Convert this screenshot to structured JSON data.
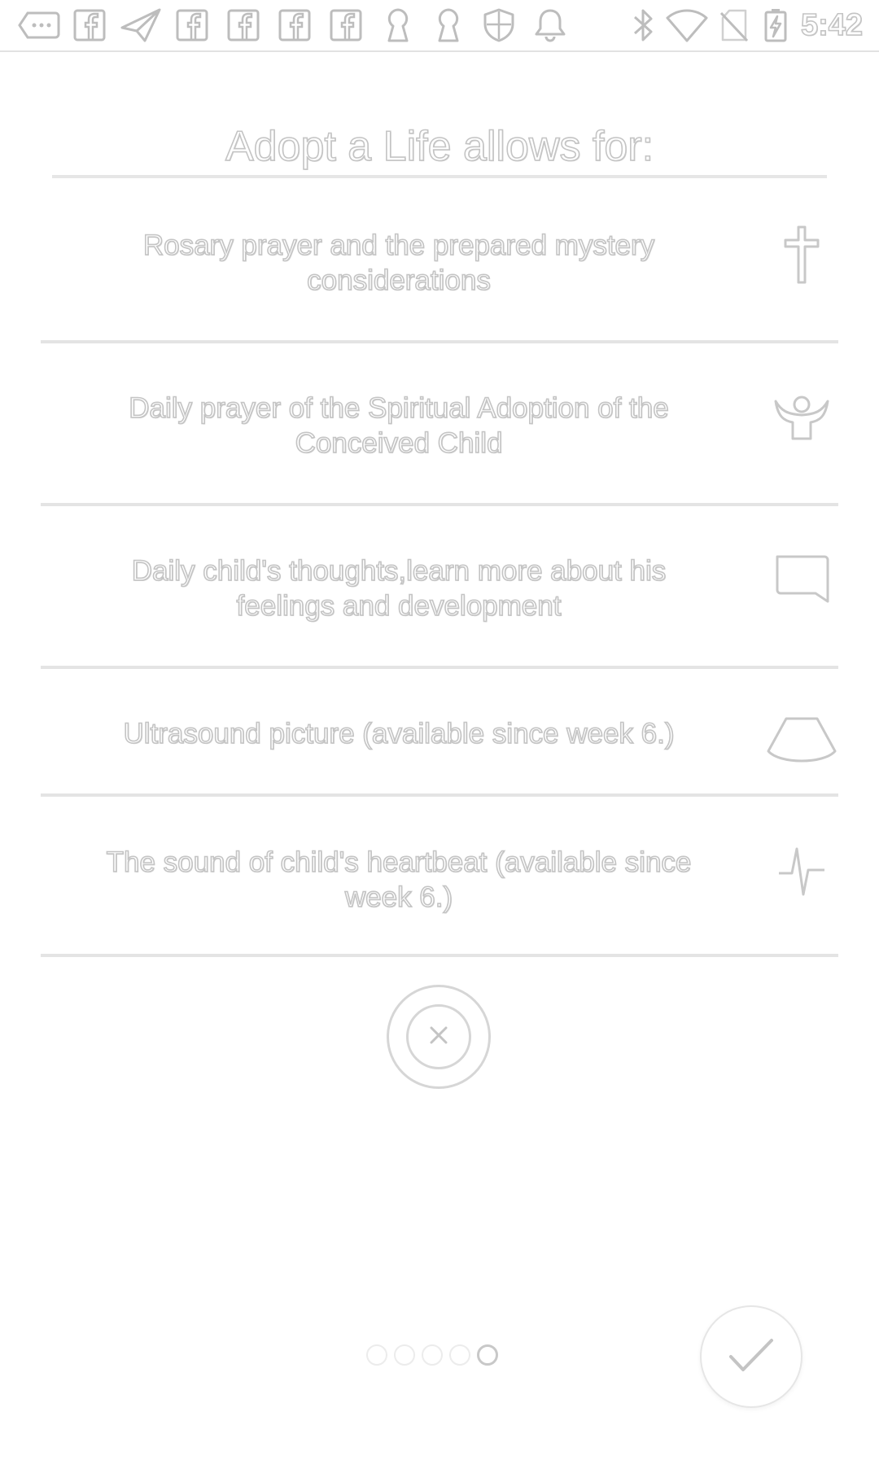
{
  "status_bar": {
    "time": "5:42",
    "notification_icons": [
      "chat-bubble-icon",
      "facebook-icon",
      "send-icon",
      "facebook-icon",
      "facebook-icon",
      "facebook-icon",
      "facebook-icon",
      "keyhole-icon",
      "keyhole-icon",
      "shield-icon",
      "bell-icon"
    ],
    "system_icons": [
      "bluetooth-icon",
      "wifi-icon",
      "no-sim-icon",
      "battery-charging-icon"
    ]
  },
  "screen": {
    "title": "Adopt a Life allows for:"
  },
  "features": [
    {
      "text": "Rosary prayer and the prepared mystery considerations",
      "icon": "cross-icon"
    },
    {
      "text": "Daily prayer of the Spiritual Adoption of the Conceived Child",
      "icon": "praying-person-icon"
    },
    {
      "text": "Daily child's thoughts,learn more about his feelings and development",
      "icon": "speech-bubble-icon"
    },
    {
      "text": "Ultrasound picture (available since week 6.)",
      "icon": "ultrasound-icon"
    },
    {
      "text": "The sound of child's heartbeat (available since week 6.)",
      "icon": "heartbeat-icon"
    }
  ],
  "close_button": {
    "icon": "close-icon"
  },
  "pager": {
    "total": 5,
    "active_index": 4
  },
  "done_button": {
    "icon": "checkmark-icon"
  },
  "colors": {
    "outline": "#c4c4c4",
    "divider": "#e4e4e4",
    "background": "#ffffff"
  }
}
